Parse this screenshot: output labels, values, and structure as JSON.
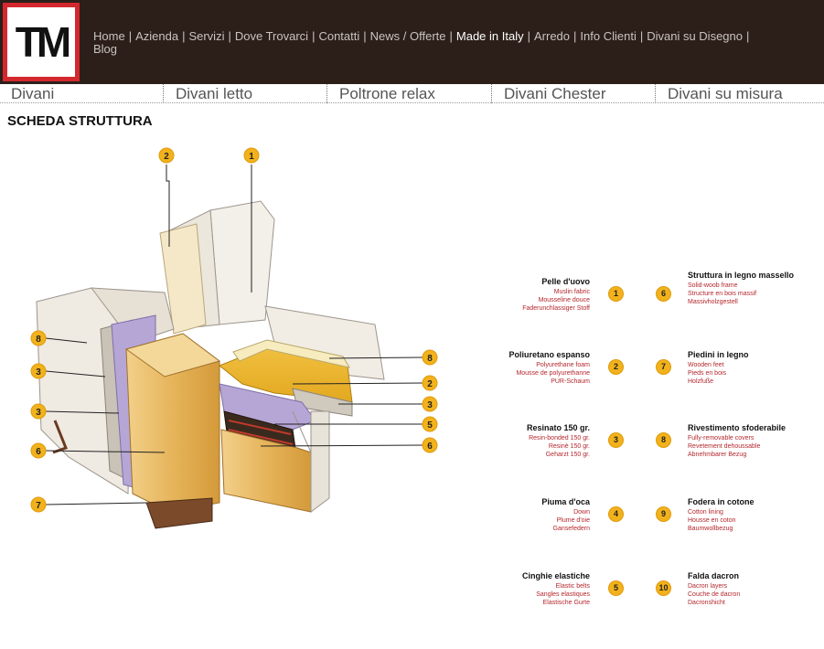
{
  "logo": {
    "text": "TM"
  },
  "nav": {
    "items": [
      {
        "label": "Home"
      },
      {
        "label": "Azienda"
      },
      {
        "label": "Servizi"
      },
      {
        "label": "Dove Trovarci"
      },
      {
        "label": "Contatti"
      },
      {
        "label": "News / Offerte"
      },
      {
        "label": "Made in Italy",
        "active": true
      },
      {
        "label": "Arredo"
      },
      {
        "label": "Info Clienti"
      },
      {
        "label": "Divani su Disegno"
      },
      {
        "label": "Blog"
      }
    ],
    "separator": "|"
  },
  "categories": [
    {
      "label": "Divani"
    },
    {
      "label": "Divani letto"
    },
    {
      "label": "Poltrone relax"
    },
    {
      "label": "Divani Chester"
    },
    {
      "label": "Divani su misura"
    }
  ],
  "page_title": "SCHEDA STRUTTURA",
  "illustration_callouts": [
    "1",
    "2",
    "8",
    "3",
    "3",
    "6",
    "7",
    "8",
    "2",
    "3",
    "5",
    "6"
  ],
  "legend": [
    {
      "num": "1",
      "title": "Pelle d'uovo",
      "subs": [
        "Muslin fabric",
        "Mousseline douce",
        "Faderunchlassiger Stoff"
      ]
    },
    {
      "num": "2",
      "title": "Poliuretano espanso",
      "subs": [
        "Polyurethane foam",
        "Mousse de polyurethanne",
        "PUR-Schaum"
      ]
    },
    {
      "num": "3",
      "title": "Resinato 150 gr.",
      "subs": [
        "Resin-bonded 150 gr.",
        "Resinè 150 gr.",
        "Geharzt 150 gr."
      ]
    },
    {
      "num": "4",
      "title": "Piuma d'oca",
      "subs": [
        "Down",
        "Plume d'oie",
        "Gansefedern"
      ]
    },
    {
      "num": "5",
      "title": "Cinghie elastiche",
      "subs": [
        "Elastic belts",
        "Sangles elastiques",
        "Elastische Gurte"
      ]
    },
    {
      "num": "6",
      "title": "Struttura in legno massello",
      "subs": [
        "Solid-woob frame",
        "Structure en bois massif",
        "Massivholzgestell"
      ]
    },
    {
      "num": "7",
      "title": "Piedini in legno",
      "subs": [
        "Wooden feet",
        "Pieds en bois",
        "Holzfuße"
      ]
    },
    {
      "num": "8",
      "title": "Rivestimento sfoderabile",
      "subs": [
        "Fully-removable covers",
        "Revetement dehoussable",
        "Abnehmbarer Bezug"
      ]
    },
    {
      "num": "9",
      "title": "Fodera in cotone",
      "subs": [
        "Cotton lining",
        "Housse en coton",
        "Baumwollbezug"
      ]
    },
    {
      "num": "10",
      "title": "Falda dacron",
      "subs": [
        "Dacron layers",
        "Couche de dacron",
        "Dacronshicht"
      ]
    }
  ]
}
